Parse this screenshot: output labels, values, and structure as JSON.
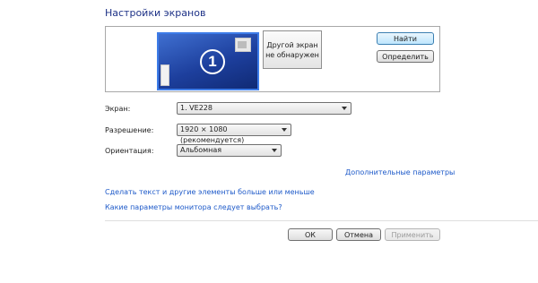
{
  "title": "Настройки экранов",
  "preview": {
    "monitor1_number": "1",
    "monitor2_line1": "Другой экран",
    "monitor2_line2": "не обнаружен"
  },
  "buttons": {
    "find": "Найти",
    "detect": "Определить",
    "ok": "ОК",
    "cancel": "Отмена",
    "apply": "Применить"
  },
  "fields": {
    "screen_label": "Экран:",
    "screen_value": "1. VE228",
    "resolution_label": "Разрешение:",
    "resolution_value": "1920 × 1080 (рекомендуется)",
    "orientation_label": "Ориентация:",
    "orientation_value": "Альбомная"
  },
  "links": {
    "advanced": "Дополнительные параметры",
    "text_size": "Сделать текст и другие элементы больше или меньше",
    "which_params": "Какие параметры монитора следует выбрать?"
  },
  "colors": {
    "title": "#1e3287",
    "link": "#1e5ac9",
    "monitor_accent": "#3d7ce8"
  }
}
